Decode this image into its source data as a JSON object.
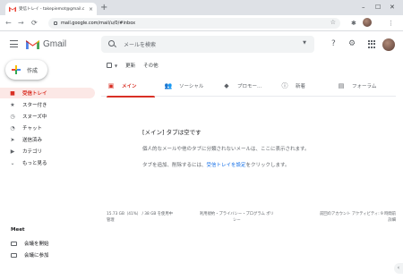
{
  "browser": {
    "tab_title": "受信トレイ - takepiemot@gmail.c",
    "tab_close": "×",
    "new_tab": "+",
    "window_controls": [
      "–",
      "☐",
      "✕"
    ],
    "back": "←",
    "forward": "→",
    "reload": "⟳",
    "url": "mail.google.com/mail/u/0/#inbox",
    "bookmark_star": "☆"
  },
  "header": {
    "brand": "Gmail",
    "search_placeholder": "メールを検索",
    "search_options": "▼",
    "help_icon": "?",
    "settings_icon": "⚙"
  },
  "compose": {
    "label": "作成"
  },
  "sidebar": {
    "items": [
      {
        "icon": "■",
        "label": "受信トレイ"
      },
      {
        "icon": "★",
        "label": "スター付き"
      },
      {
        "icon": "◷",
        "label": "スヌーズ中"
      },
      {
        "icon": "◔",
        "label": "チャット"
      },
      {
        "icon": "➤",
        "label": "送信済み"
      },
      {
        "icon": "▶",
        "label": "カテゴリ"
      },
      {
        "icon": "⌄",
        "label": "もっと見る"
      }
    ]
  },
  "meet": {
    "title": "Meet",
    "items": [
      {
        "label": "会議を開始"
      },
      {
        "label": "会議に参加"
      }
    ]
  },
  "toolbar": {
    "dropdown": "▼",
    "refresh": "更新",
    "more": "その他"
  },
  "tabs": [
    {
      "icon": "▣",
      "label": "メイン"
    },
    {
      "icon": "👥",
      "label": "ソーシャル"
    },
    {
      "icon": "◆",
      "label": "プロモー..."
    },
    {
      "icon": "ⓘ",
      "label": "新着"
    },
    {
      "icon": "▤",
      "label": "フォーラム"
    }
  ],
  "empty_state": {
    "title": "[メイン] タブは空です",
    "text1": "個人的なメールや他のタブに分類されないメールは、ここに表示されます。",
    "text2_before": "タブを追加、削除するには、",
    "text2_link": "受信トレイを設定",
    "text2_after": "をクリックします。"
  },
  "footer": {
    "storage": "15.73 GB（41%） / 38 GB を使用中",
    "manage": "管理",
    "terms": "利用規約・プライバシー",
    "policy": "・プログラム ポリ",
    "policy_line2": "シー",
    "activity": "前回のアカウント アクティビティ: 9 時間前",
    "details": "詳細"
  },
  "right_toggle": "‹"
}
